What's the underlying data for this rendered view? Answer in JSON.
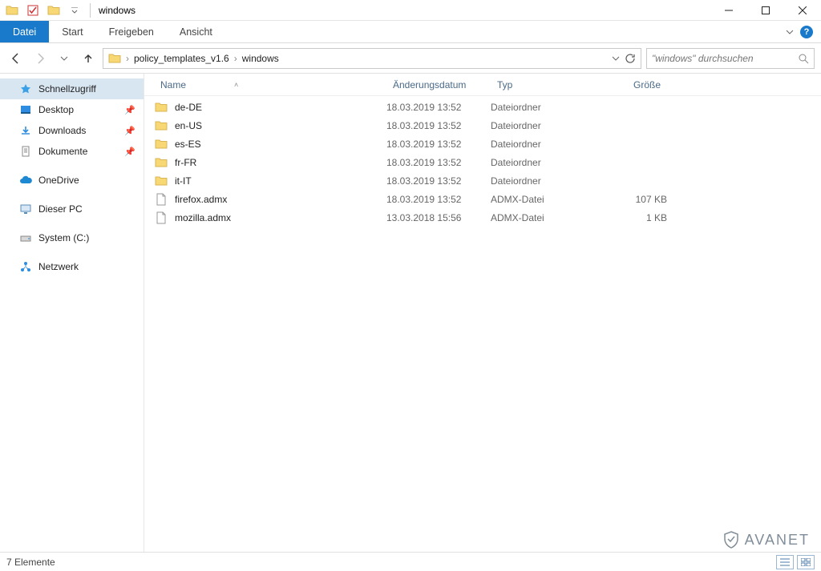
{
  "title_bar": {
    "window_title": "windows"
  },
  "ribbon": {
    "tabs": [
      {
        "label": "Datei",
        "active": true
      },
      {
        "label": "Start",
        "active": false
      },
      {
        "label": "Freigeben",
        "active": false
      },
      {
        "label": "Ansicht",
        "active": false
      }
    ]
  },
  "address": {
    "crumbs": [
      "policy_templates_v1.6",
      "windows"
    ]
  },
  "search": {
    "placeholder": "\"windows\" durchsuchen"
  },
  "sidebar": {
    "quick_access": {
      "label": "Schnellzugriff",
      "items": [
        {
          "label": "Desktop",
          "pinned": true,
          "icon": "desktop"
        },
        {
          "label": "Downloads",
          "pinned": true,
          "icon": "download"
        },
        {
          "label": "Dokumente",
          "pinned": true,
          "icon": "document"
        }
      ]
    },
    "onedrive": {
      "label": "OneDrive"
    },
    "this_pc": {
      "label": "Dieser PC"
    },
    "system_c": {
      "label": "System (C:)"
    },
    "network": {
      "label": "Netzwerk"
    }
  },
  "columns": {
    "name": "Name",
    "date": "Änderungsdatum",
    "type": "Typ",
    "size": "Größe"
  },
  "rows": [
    {
      "icon": "folder",
      "name": "de-DE",
      "date": "18.03.2019 13:52",
      "type": "Dateiordner",
      "size": ""
    },
    {
      "icon": "folder",
      "name": "en-US",
      "date": "18.03.2019 13:52",
      "type": "Dateiordner",
      "size": ""
    },
    {
      "icon": "folder",
      "name": "es-ES",
      "date": "18.03.2019 13:52",
      "type": "Dateiordner",
      "size": ""
    },
    {
      "icon": "folder",
      "name": "fr-FR",
      "date": "18.03.2019 13:52",
      "type": "Dateiordner",
      "size": ""
    },
    {
      "icon": "folder",
      "name": "it-IT",
      "date": "18.03.2019 13:52",
      "type": "Dateiordner",
      "size": ""
    },
    {
      "icon": "file",
      "name": "firefox.admx",
      "date": "18.03.2019 13:52",
      "type": "ADMX-Datei",
      "size": "107 KB"
    },
    {
      "icon": "file",
      "name": "mozilla.admx",
      "date": "13.03.2018 15:56",
      "type": "ADMX-Datei",
      "size": "1 KB"
    }
  ],
  "status": {
    "count_label": "7 Elemente"
  },
  "watermark": {
    "text": "AVANET"
  }
}
